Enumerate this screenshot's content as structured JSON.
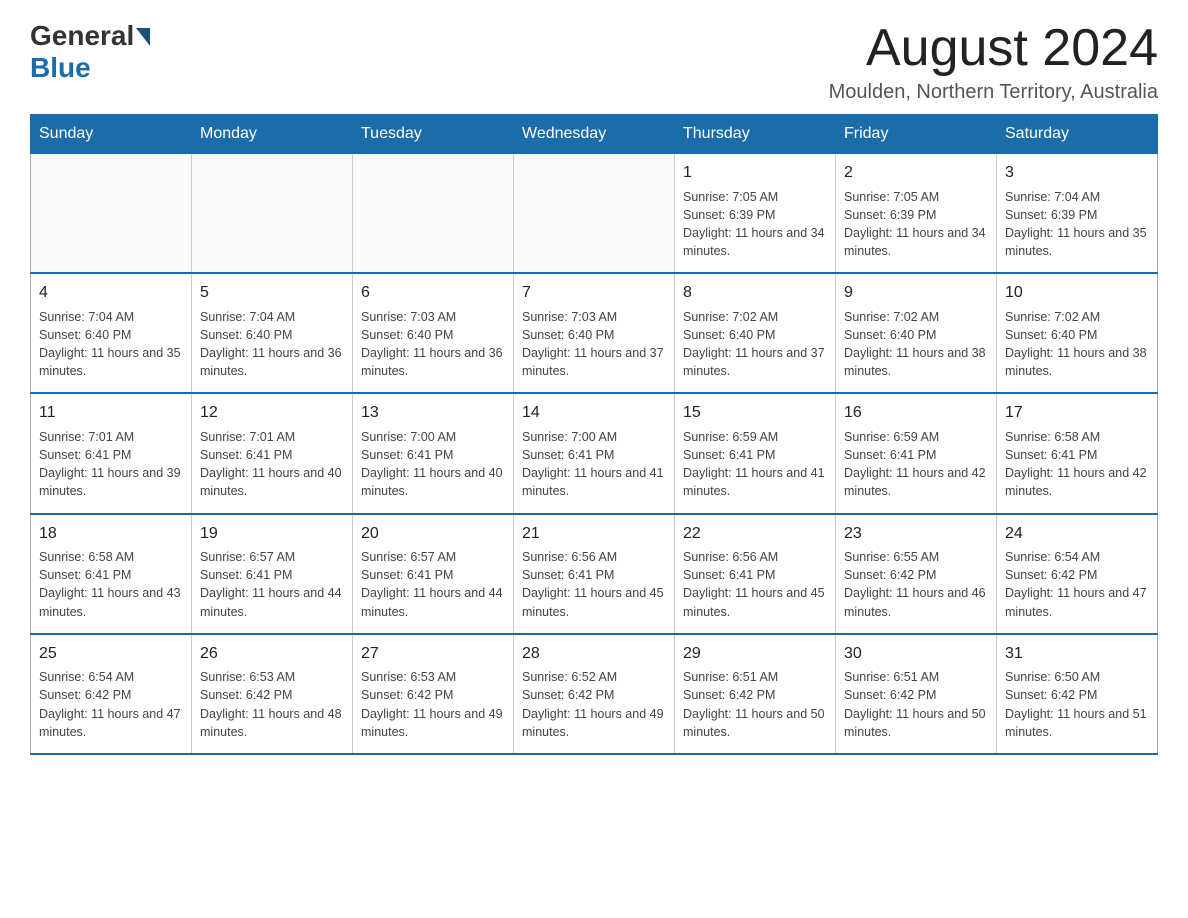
{
  "header": {
    "logo_general": "General",
    "logo_blue": "Blue",
    "month_title": "August 2024",
    "location": "Moulden, Northern Territory, Australia"
  },
  "days_of_week": [
    "Sunday",
    "Monday",
    "Tuesday",
    "Wednesday",
    "Thursday",
    "Friday",
    "Saturday"
  ],
  "weeks": [
    [
      {
        "day": "",
        "info": ""
      },
      {
        "day": "",
        "info": ""
      },
      {
        "day": "",
        "info": ""
      },
      {
        "day": "",
        "info": ""
      },
      {
        "day": "1",
        "info": "Sunrise: 7:05 AM\nSunset: 6:39 PM\nDaylight: 11 hours and 34 minutes."
      },
      {
        "day": "2",
        "info": "Sunrise: 7:05 AM\nSunset: 6:39 PM\nDaylight: 11 hours and 34 minutes."
      },
      {
        "day": "3",
        "info": "Sunrise: 7:04 AM\nSunset: 6:39 PM\nDaylight: 11 hours and 35 minutes."
      }
    ],
    [
      {
        "day": "4",
        "info": "Sunrise: 7:04 AM\nSunset: 6:40 PM\nDaylight: 11 hours and 35 minutes."
      },
      {
        "day": "5",
        "info": "Sunrise: 7:04 AM\nSunset: 6:40 PM\nDaylight: 11 hours and 36 minutes."
      },
      {
        "day": "6",
        "info": "Sunrise: 7:03 AM\nSunset: 6:40 PM\nDaylight: 11 hours and 36 minutes."
      },
      {
        "day": "7",
        "info": "Sunrise: 7:03 AM\nSunset: 6:40 PM\nDaylight: 11 hours and 37 minutes."
      },
      {
        "day": "8",
        "info": "Sunrise: 7:02 AM\nSunset: 6:40 PM\nDaylight: 11 hours and 37 minutes."
      },
      {
        "day": "9",
        "info": "Sunrise: 7:02 AM\nSunset: 6:40 PM\nDaylight: 11 hours and 38 minutes."
      },
      {
        "day": "10",
        "info": "Sunrise: 7:02 AM\nSunset: 6:40 PM\nDaylight: 11 hours and 38 minutes."
      }
    ],
    [
      {
        "day": "11",
        "info": "Sunrise: 7:01 AM\nSunset: 6:41 PM\nDaylight: 11 hours and 39 minutes."
      },
      {
        "day": "12",
        "info": "Sunrise: 7:01 AM\nSunset: 6:41 PM\nDaylight: 11 hours and 40 minutes."
      },
      {
        "day": "13",
        "info": "Sunrise: 7:00 AM\nSunset: 6:41 PM\nDaylight: 11 hours and 40 minutes."
      },
      {
        "day": "14",
        "info": "Sunrise: 7:00 AM\nSunset: 6:41 PM\nDaylight: 11 hours and 41 minutes."
      },
      {
        "day": "15",
        "info": "Sunrise: 6:59 AM\nSunset: 6:41 PM\nDaylight: 11 hours and 41 minutes."
      },
      {
        "day": "16",
        "info": "Sunrise: 6:59 AM\nSunset: 6:41 PM\nDaylight: 11 hours and 42 minutes."
      },
      {
        "day": "17",
        "info": "Sunrise: 6:58 AM\nSunset: 6:41 PM\nDaylight: 11 hours and 42 minutes."
      }
    ],
    [
      {
        "day": "18",
        "info": "Sunrise: 6:58 AM\nSunset: 6:41 PM\nDaylight: 11 hours and 43 minutes."
      },
      {
        "day": "19",
        "info": "Sunrise: 6:57 AM\nSunset: 6:41 PM\nDaylight: 11 hours and 44 minutes."
      },
      {
        "day": "20",
        "info": "Sunrise: 6:57 AM\nSunset: 6:41 PM\nDaylight: 11 hours and 44 minutes."
      },
      {
        "day": "21",
        "info": "Sunrise: 6:56 AM\nSunset: 6:41 PM\nDaylight: 11 hours and 45 minutes."
      },
      {
        "day": "22",
        "info": "Sunrise: 6:56 AM\nSunset: 6:41 PM\nDaylight: 11 hours and 45 minutes."
      },
      {
        "day": "23",
        "info": "Sunrise: 6:55 AM\nSunset: 6:42 PM\nDaylight: 11 hours and 46 minutes."
      },
      {
        "day": "24",
        "info": "Sunrise: 6:54 AM\nSunset: 6:42 PM\nDaylight: 11 hours and 47 minutes."
      }
    ],
    [
      {
        "day": "25",
        "info": "Sunrise: 6:54 AM\nSunset: 6:42 PM\nDaylight: 11 hours and 47 minutes."
      },
      {
        "day": "26",
        "info": "Sunrise: 6:53 AM\nSunset: 6:42 PM\nDaylight: 11 hours and 48 minutes."
      },
      {
        "day": "27",
        "info": "Sunrise: 6:53 AM\nSunset: 6:42 PM\nDaylight: 11 hours and 49 minutes."
      },
      {
        "day": "28",
        "info": "Sunrise: 6:52 AM\nSunset: 6:42 PM\nDaylight: 11 hours and 49 minutes."
      },
      {
        "day": "29",
        "info": "Sunrise: 6:51 AM\nSunset: 6:42 PM\nDaylight: 11 hours and 50 minutes."
      },
      {
        "day": "30",
        "info": "Sunrise: 6:51 AM\nSunset: 6:42 PM\nDaylight: 11 hours and 50 minutes."
      },
      {
        "day": "31",
        "info": "Sunrise: 6:50 AM\nSunset: 6:42 PM\nDaylight: 11 hours and 51 minutes."
      }
    ]
  ]
}
